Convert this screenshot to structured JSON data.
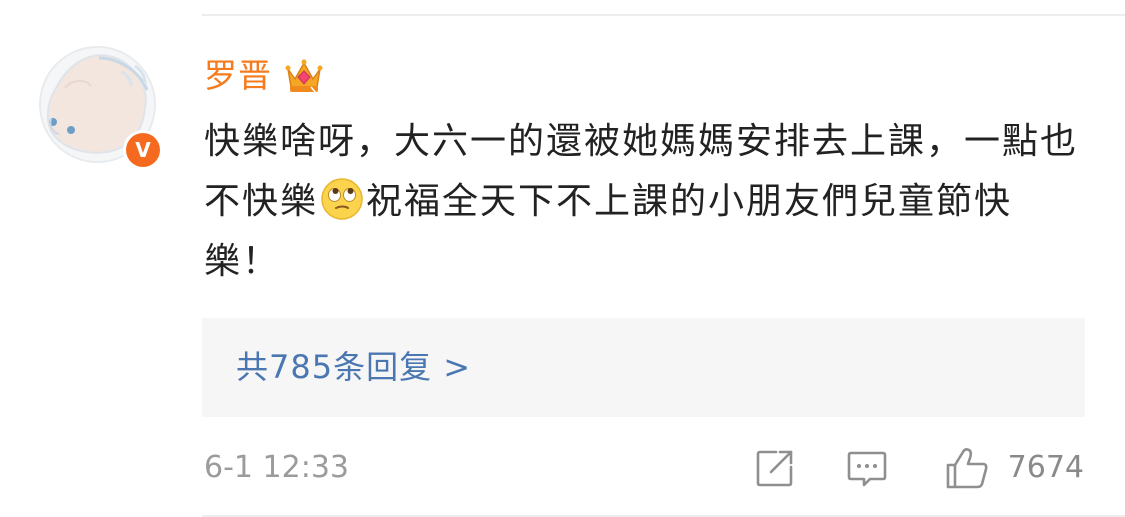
{
  "comment": {
    "username": "罗晋",
    "verified_badge": "V",
    "text_part1": "快樂啥呀，大六一的還被她媽媽安排去上課，一點也不快樂",
    "emoji": "rolling-eyes-emoji",
    "text_part2": "祝福全天下不上課的小朋友們兒童節快樂！",
    "replies_label": "共785条回复 >",
    "timestamp": "6-1 12:33",
    "like_count": "7674"
  },
  "icons": {
    "crown": "crown-icon",
    "share": "share-icon",
    "comment": "comment-icon",
    "like": "like-icon"
  },
  "colors": {
    "username": "#f47b1e",
    "link": "#4a77b2",
    "badge": "#f56a1f",
    "muted": "#9b9b9b"
  }
}
